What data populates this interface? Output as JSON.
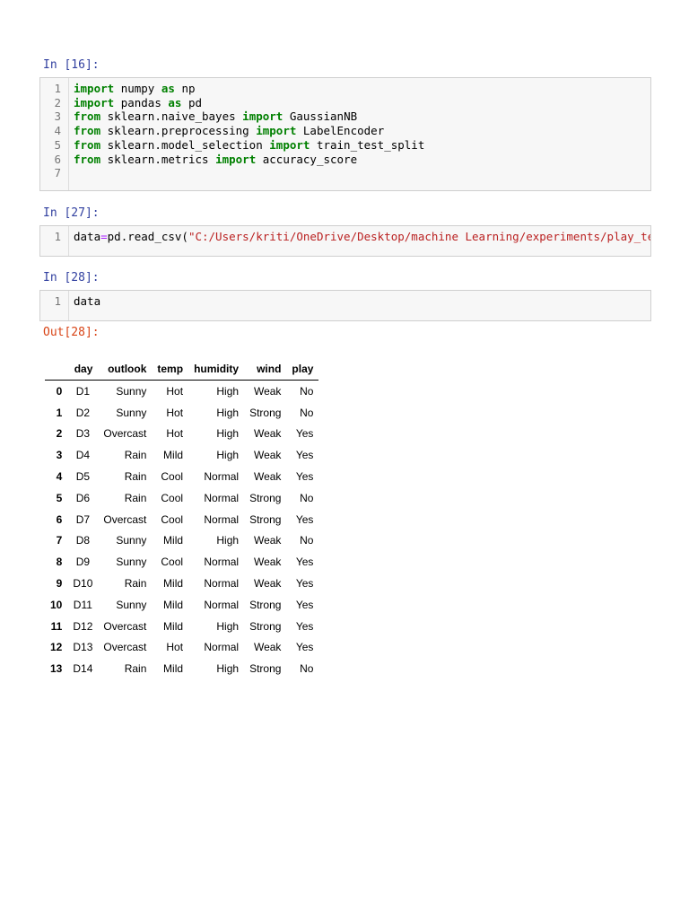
{
  "cells": [
    {
      "prompt": "In [16]:",
      "lines": [
        "1",
        "2",
        "3",
        "4",
        "5",
        "6",
        "7"
      ]
    },
    {
      "prompt": "In [27]:",
      "lines": [
        "1"
      ]
    },
    {
      "prompt": "In [28]:",
      "lines": [
        "1"
      ]
    }
  ],
  "code1": [
    [
      [
        "kw",
        "import"
      ],
      [
        "",
        "numpy"
      ],
      [
        "kw",
        "as"
      ],
      [
        "",
        "np"
      ]
    ],
    [
      [
        "kw",
        "import"
      ],
      [
        "",
        "pandas"
      ],
      [
        "kw",
        "as"
      ],
      [
        "",
        "pd"
      ]
    ],
    [
      [
        "kw",
        "from"
      ],
      [
        "",
        "sklearn.naive_bayes"
      ],
      [
        "kw",
        "import"
      ],
      [
        "",
        "GaussianNB"
      ]
    ],
    [
      [
        "kw",
        "from"
      ],
      [
        "",
        "sklearn.preprocessing"
      ],
      [
        "kw",
        "import"
      ],
      [
        "",
        "LabelEncoder"
      ]
    ],
    [
      [
        "kw",
        "from"
      ],
      [
        "",
        "sklearn.model_selection"
      ],
      [
        "kw",
        "import"
      ],
      [
        "",
        "train_test_split"
      ]
    ],
    [
      [
        "kw",
        "from"
      ],
      [
        "",
        "sklearn.metrics"
      ],
      [
        "kw",
        "import"
      ],
      [
        "",
        "accuracy_score"
      ]
    ]
  ],
  "code2": {
    "var": "data",
    "op": "=",
    "call": "pd.read_csv(",
    "str": "\"C:/Users/kriti/OneDrive/Desktop/machine Learning/experiments/play_tennis.csv\")"
  },
  "code3": "data",
  "out_prompt": "Out[28]:",
  "table": {
    "columns": [
      "",
      "day",
      "outlook",
      "temp",
      "humidity",
      "wind",
      "play"
    ],
    "rows": [
      [
        "0",
        "D1",
        "Sunny",
        "Hot",
        "High",
        "Weak",
        "No"
      ],
      [
        "1",
        "D2",
        "Sunny",
        "Hot",
        "High",
        "Strong",
        "No"
      ],
      [
        "2",
        "D3",
        "Overcast",
        "Hot",
        "High",
        "Weak",
        "Yes"
      ],
      [
        "3",
        "D4",
        "Rain",
        "Mild",
        "High",
        "Weak",
        "Yes"
      ],
      [
        "4",
        "D5",
        "Rain",
        "Cool",
        "Normal",
        "Weak",
        "Yes"
      ],
      [
        "5",
        "D6",
        "Rain",
        "Cool",
        "Normal",
        "Strong",
        "No"
      ],
      [
        "6",
        "D7",
        "Overcast",
        "Cool",
        "Normal",
        "Strong",
        "Yes"
      ],
      [
        "7",
        "D8",
        "Sunny",
        "Mild",
        "High",
        "Weak",
        "No"
      ],
      [
        "8",
        "D9",
        "Sunny",
        "Cool",
        "Normal",
        "Weak",
        "Yes"
      ],
      [
        "9",
        "D10",
        "Rain",
        "Mild",
        "Normal",
        "Weak",
        "Yes"
      ],
      [
        "10",
        "D11",
        "Sunny",
        "Mild",
        "Normal",
        "Strong",
        "Yes"
      ],
      [
        "11",
        "D12",
        "Overcast",
        "Mild",
        "High",
        "Strong",
        "Yes"
      ],
      [
        "12",
        "D13",
        "Overcast",
        "Hot",
        "Normal",
        "Weak",
        "Yes"
      ],
      [
        "13",
        "D14",
        "Rain",
        "Mild",
        "High",
        "Strong",
        "No"
      ]
    ]
  }
}
